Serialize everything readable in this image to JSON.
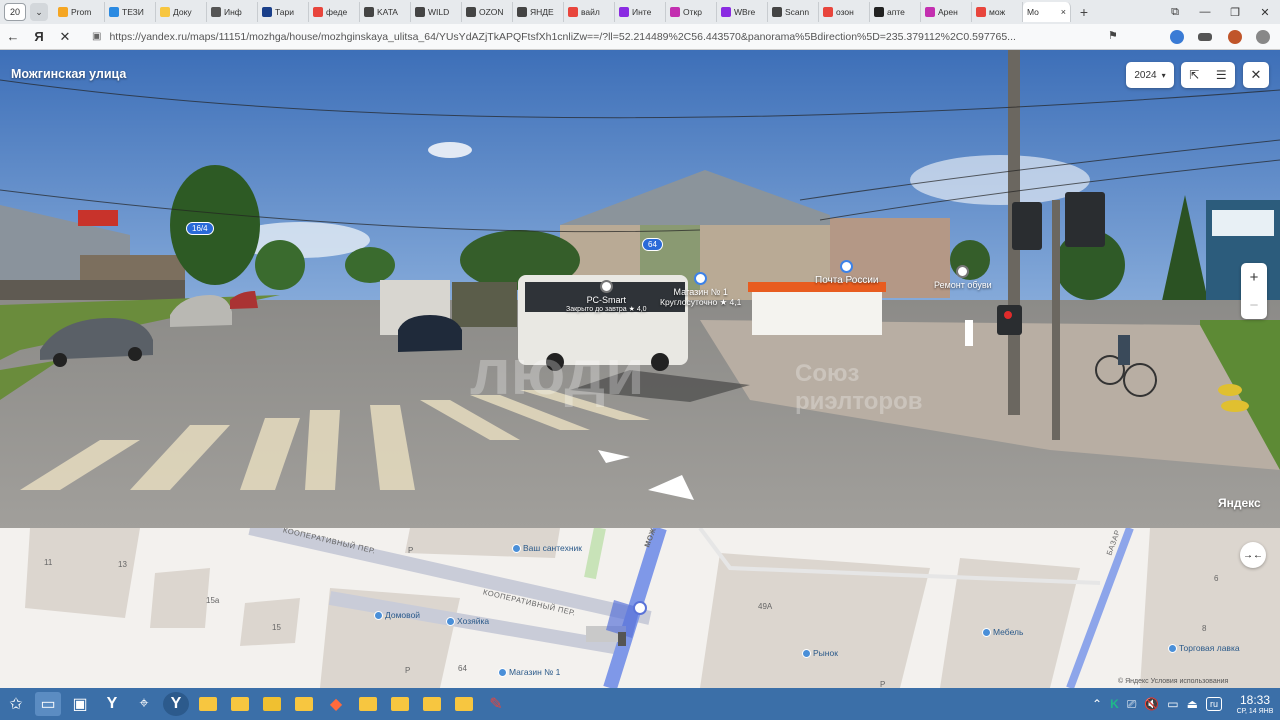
{
  "browser": {
    "tab_counter": "20",
    "tabs": [
      {
        "label": "Prom",
        "color": "#f5a623"
      },
      {
        "label": "ТЕЗИ",
        "color": "#2a8ae2"
      },
      {
        "label": "Доку",
        "color": "#f7c640"
      },
      {
        "label": "Инф",
        "color": "#555555"
      },
      {
        "label": "Тари",
        "color": "#1a3f8a"
      },
      {
        "label": "феде",
        "color": "#e8453c"
      },
      {
        "label": "KATA",
        "color": "#444444"
      },
      {
        "label": "WILD",
        "color": "#444444"
      },
      {
        "label": "OZON",
        "color": "#444444"
      },
      {
        "label": "ЯНДЕ",
        "color": "#444444"
      },
      {
        "label": "вайл",
        "color": "#e8453c"
      },
      {
        "label": "Инте",
        "color": "#8a2be2"
      },
      {
        "label": "Откр",
        "color": "#c32fb0"
      },
      {
        "label": "WBre",
        "color": "#8a2be2"
      },
      {
        "label": "Scann",
        "color": "#444444"
      },
      {
        "label": "озон",
        "color": "#e8453c"
      },
      {
        "label": "апте",
        "color": "#222222"
      },
      {
        "label": "Арен",
        "color": "#c32fb0"
      },
      {
        "label": "мож",
        "color": "#e8453c"
      }
    ],
    "active_tab": {
      "label": "Мо",
      "close": "×"
    },
    "new_tab": "+",
    "url": "https://yandex.ru/maps/11151/mozhga/house/mozhginskaya_ulitsa_64/YUsYdAZjTkAPQFtsfXh1cnliZw==/?ll=52.214489%2C56.443570&panorama%5Bdirection%5D=235.379112%2C0.597765..."
  },
  "panorama": {
    "street_name": "Можгинская улица",
    "year": "2024",
    "year_arrow": "▾",
    "zoom_in": "+",
    "zoom_out": "−",
    "close": "✕",
    "badges": [
      {
        "text": "16/4"
      },
      {
        "text": "64"
      }
    ],
    "pois": [
      {
        "name": "РС-Smart",
        "sub": "Закрыто до завтра ★ 4,0"
      },
      {
        "name": "Магазин № 1",
        "sub": "Круглосуточно ★ 4,1"
      },
      {
        "name": "Почта России",
        "sub": ""
      },
      {
        "name": "Ремонт обуви",
        "sub": ""
      }
    ],
    "watermark_main": "люди",
    "watermark_sub1": "Союз",
    "watermark_sub2": "риэлторов",
    "provider": "Яндекс"
  },
  "map": {
    "house_numbers": [
      "11",
      "13",
      "15а",
      "15",
      "64",
      "49А",
      "6",
      "8",
      "Р",
      "Р",
      "Р"
    ],
    "streets": [
      "КООПЕРАТИВНЫЙ ПЕР.",
      "КООПЕРАТИВНЫЙ ПЕР.",
      "МОЖ",
      "БАЗАР"
    ],
    "pois": [
      "Ваш сантехник",
      "Домовой",
      "Хозяйка",
      "Магазин № 1",
      "Мебель",
      "Рынок",
      "Торговая лавка"
    ],
    "copyright": "© Яндекс  Условия использования",
    "collapse": "→←"
  },
  "taskbar": {
    "time": "18:33",
    "date": "СР, 14 ЯНВ",
    "lang": "ru"
  }
}
